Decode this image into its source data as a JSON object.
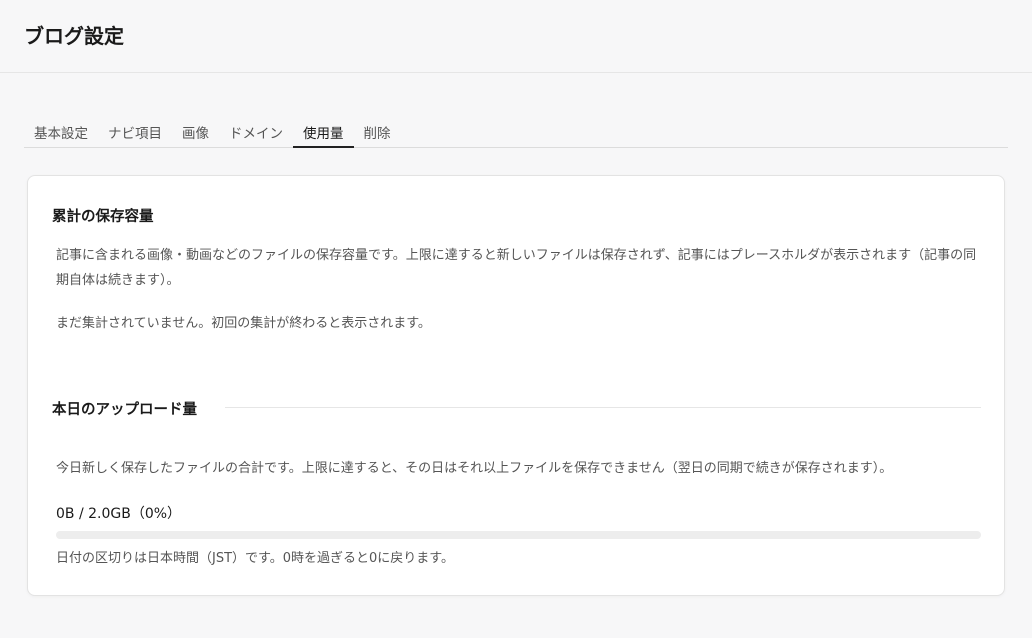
{
  "header": {
    "title": "ブログ設定"
  },
  "tabs": [
    {
      "label": "基本設定"
    },
    {
      "label": "ナビ項目"
    },
    {
      "label": "画像"
    },
    {
      "label": "ドメイン"
    },
    {
      "label": "使用量",
      "active": true
    },
    {
      "label": "削除"
    }
  ],
  "storage": {
    "title": "累計の保存容量",
    "description": "記事に含まれる画像・動画などのファイルの保存容量です。上限に達すると新しいファイルは保存されず、記事にはプレースホルダが表示されます（記事の同期自体は続きます）。",
    "status": "まだ集計されていません。初回の集計が終わると表示されます。"
  },
  "upload": {
    "title": "本日のアップロード量",
    "description": "今日新しく保存したファイルの合計です。上限に達すると、その日はそれ以上ファイルを保存できません（翌日の同期で続きが保存されます）。",
    "usage": "0B / 2.0GB（0%）",
    "progress_percent": 0,
    "note": "日付の区切りは日本時間（JST）です。0時を過ぎると0に戻ります。"
  }
}
